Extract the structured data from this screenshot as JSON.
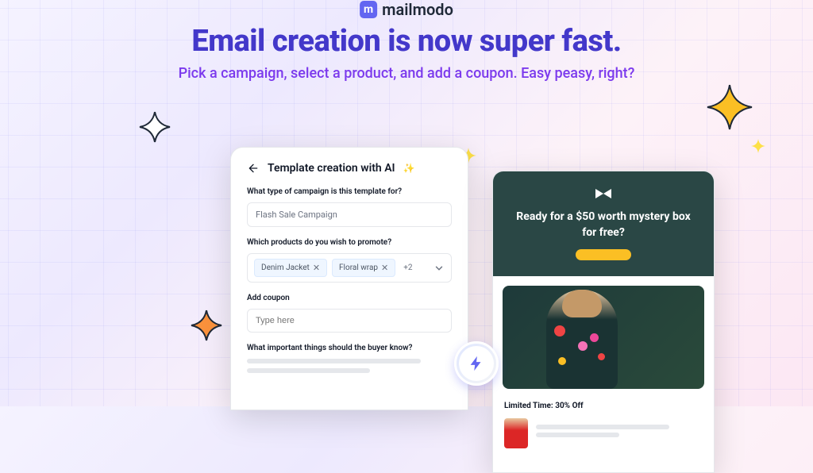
{
  "logo": {
    "name": "mailmodo",
    "mark": "m"
  },
  "headline": "Email creation is now super fast.",
  "subheadline": "Pick a campaign, select a product, and add a coupon. Easy peasy, right?",
  "form": {
    "title": "Template creation with AI",
    "q1_label": "What type of campaign is this template for?",
    "q1_value": "Flash Sale Campaign",
    "q2_label": "Which products do you wish to promote?",
    "chips": [
      "Denim Jacket",
      "Floral wrap"
    ],
    "chip_more": "+2",
    "q3_label": "Add coupon",
    "q3_placeholder": "Type here",
    "q4_label": "What important things should the buyer know?"
  },
  "preview": {
    "hero_title": "Ready for a $50 worth mystery box for free?",
    "promo": "Limited Time: 30% Off"
  }
}
